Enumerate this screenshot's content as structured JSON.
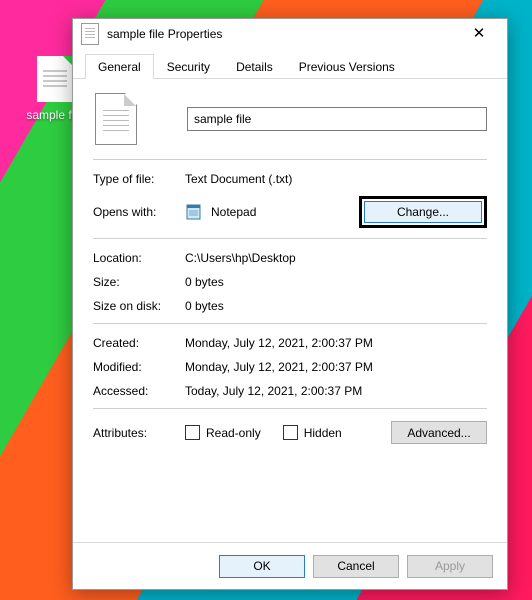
{
  "desktop_icon_label": "sample file",
  "window_title": "sample file Properties",
  "tabs": {
    "general": "General",
    "security": "Security",
    "details": "Details",
    "previous": "Previous Versions"
  },
  "filename": "sample file",
  "labels": {
    "type_of_file": "Type of file:",
    "opens_with": "Opens with:",
    "location": "Location:",
    "size": "Size:",
    "size_on_disk": "Size on disk:",
    "created": "Created:",
    "modified": "Modified:",
    "accessed": "Accessed:",
    "attributes": "Attributes:",
    "read_only": "Read-only",
    "hidden": "Hidden"
  },
  "values": {
    "type_of_file": "Text Document (.txt)",
    "opens_with": "Notepad",
    "location": "C:\\Users\\hp\\Desktop",
    "size": "0 bytes",
    "size_on_disk": "0 bytes",
    "created": "Monday, July 12, 2021, 2:00:37 PM",
    "modified": "Monday, July 12, 2021, 2:00:37 PM",
    "accessed": "Today, July 12, 2021, 2:00:37 PM"
  },
  "buttons": {
    "change": "Change...",
    "advanced": "Advanced...",
    "ok": "OK",
    "cancel": "Cancel",
    "apply": "Apply"
  }
}
